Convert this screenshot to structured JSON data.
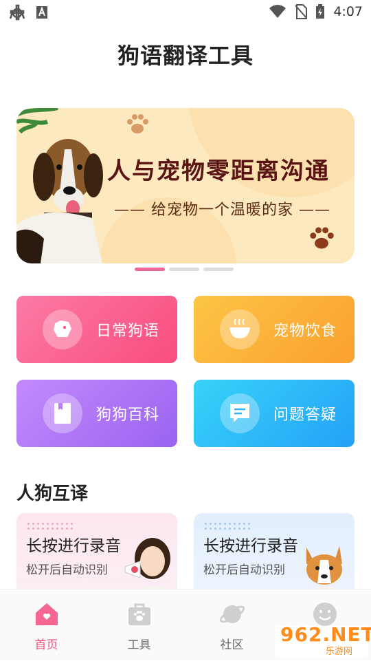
{
  "status_bar": {
    "time": "4:07"
  },
  "page": {
    "title": "狗语翻译工具"
  },
  "banner": {
    "headline": "人与宠物零距离沟通",
    "subline": "—— 给宠物一个温暖的家 ——",
    "active_slide": 1,
    "slide_count": 3
  },
  "cards": [
    {
      "label": "日常狗语"
    },
    {
      "label": "宠物饮食"
    },
    {
      "label": "狗狗百科"
    },
    {
      "label": "问题答疑"
    }
  ],
  "translate": {
    "section_title": "人狗互译",
    "items": [
      {
        "title": "长按进行录音",
        "subtitle": "松开后自动识别"
      },
      {
        "title": "长按进行录音",
        "subtitle": "松开后自动识别"
      }
    ]
  },
  "tabbar": [
    {
      "label": "首页",
      "active": true
    },
    {
      "label": "工具",
      "active": false
    },
    {
      "label": "社区",
      "active": false
    },
    {
      "label": "",
      "active": false
    }
  ],
  "watermark": {
    "big": "962.NET",
    "small": "乐游网"
  },
  "colors": {
    "accent": "#f04f7e",
    "pink_card": "#f84d7d",
    "orange_card": "#fba030",
    "purple_card": "#9a63f0",
    "blue_card": "#24a1f7"
  }
}
